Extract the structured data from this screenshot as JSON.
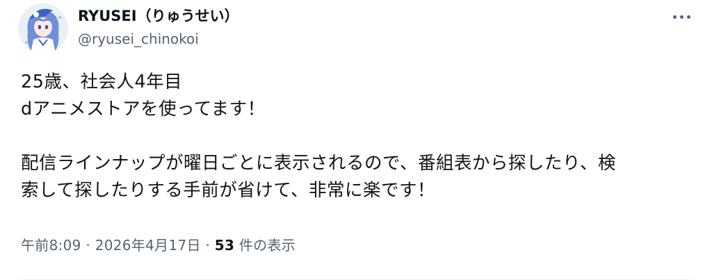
{
  "author": {
    "display_name": "RYUSEI（りゅうせい）",
    "handle": "@ryusei_chinokoi",
    "avatar_icon": "user-avatar-anime-character"
  },
  "menu": {
    "icon": "more-options-icon"
  },
  "tweet": {
    "line1": "25歳、社会人4年目",
    "line2": "dアニメストアを使ってます！",
    "line3": "配信ラインナップが曜日ごとに表示されるので、番組表から探したり、検",
    "line4": "索して探したりする手前が省けて、非常に楽です！"
  },
  "meta": {
    "time": "午前8:09",
    "separator1": " · ",
    "date": "2026年4月17日",
    "separator2": " · ",
    "views_count": "53",
    "views_label": " 件の表示"
  },
  "colors": {
    "text_primary": "#0f1419",
    "text_secondary": "#536471",
    "divider": "#eff3f4"
  }
}
